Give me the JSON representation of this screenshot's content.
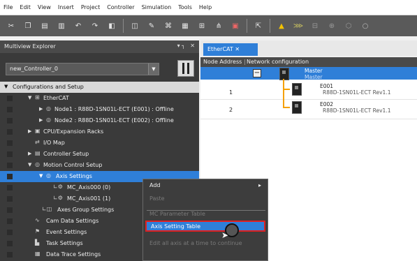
{
  "menubar": {
    "items": [
      "File",
      "Edit",
      "View",
      "Insert",
      "Project",
      "Controller",
      "Simulation",
      "Tools",
      "Help"
    ]
  },
  "toolbar": {
    "icons": [
      "cut-icon",
      "copy-icon",
      "paste-icon",
      "delete-icon",
      "undo-icon",
      "redo-icon",
      "build-icon",
      "monitor-icon",
      "settings-icon",
      "network-icon",
      "table-icon",
      "io-icon",
      "search-icon",
      "tag-icon",
      "warning-icon",
      "axis-icon",
      "sync-icon",
      "run-icon",
      "stop-icon",
      "circle-icon"
    ]
  },
  "explorer": {
    "title": "Multiview Explorer",
    "pin": "▾ ┐",
    "close": "✕",
    "controller": "new_Controller_0",
    "tree": {
      "config": "Configurations and Setup",
      "ethercat": "EtherCAT",
      "node1": "Node1 : R88D-1SN01L-ECT (E001) : Offline",
      "node2": "Node2 : R88D-1SN01L-ECT (E002) : Offline",
      "cpu": "CPU/Expansion Racks",
      "io": "I/O Map",
      "controller_setup": "Controller Setup",
      "motion": "Motion Control Setup",
      "axis_settings": "Axis Settings",
      "axis0": "MC_Axis000 (0)",
      "axis1": "MC_Axis001 (1)",
      "axes_group": "Axes Group Settings",
      "cam": "Cam Data Settings",
      "event": "Event Settings",
      "task": "Task Settings",
      "trace": "Data Trace Settings"
    }
  },
  "editor": {
    "tab_label": "EtherCAT ✕",
    "col_node": "Node Address",
    "col_net": "Network configuration",
    "master_label": "Master",
    "master_sub": "Master",
    "nodes": [
      {
        "num": "1",
        "id": "E001",
        "model": "R88D-1SN01L-ECT Rev1.1"
      },
      {
        "num": "2",
        "id": "E002",
        "model": "R88D-1SN01L-ECT Rev1.1"
      }
    ]
  },
  "context_menu": {
    "add": "Add",
    "paste": "Paste",
    "mc_param": "MC Parameter Table",
    "axis_table": "Axis Setting Table",
    "blurred": "Edit all axis at a time to continue",
    "submenu_arrow": "▸"
  },
  "colors": {
    "selection": "#2f7fd8",
    "highlight_border": "#e02020",
    "connector": "#f5a000"
  }
}
